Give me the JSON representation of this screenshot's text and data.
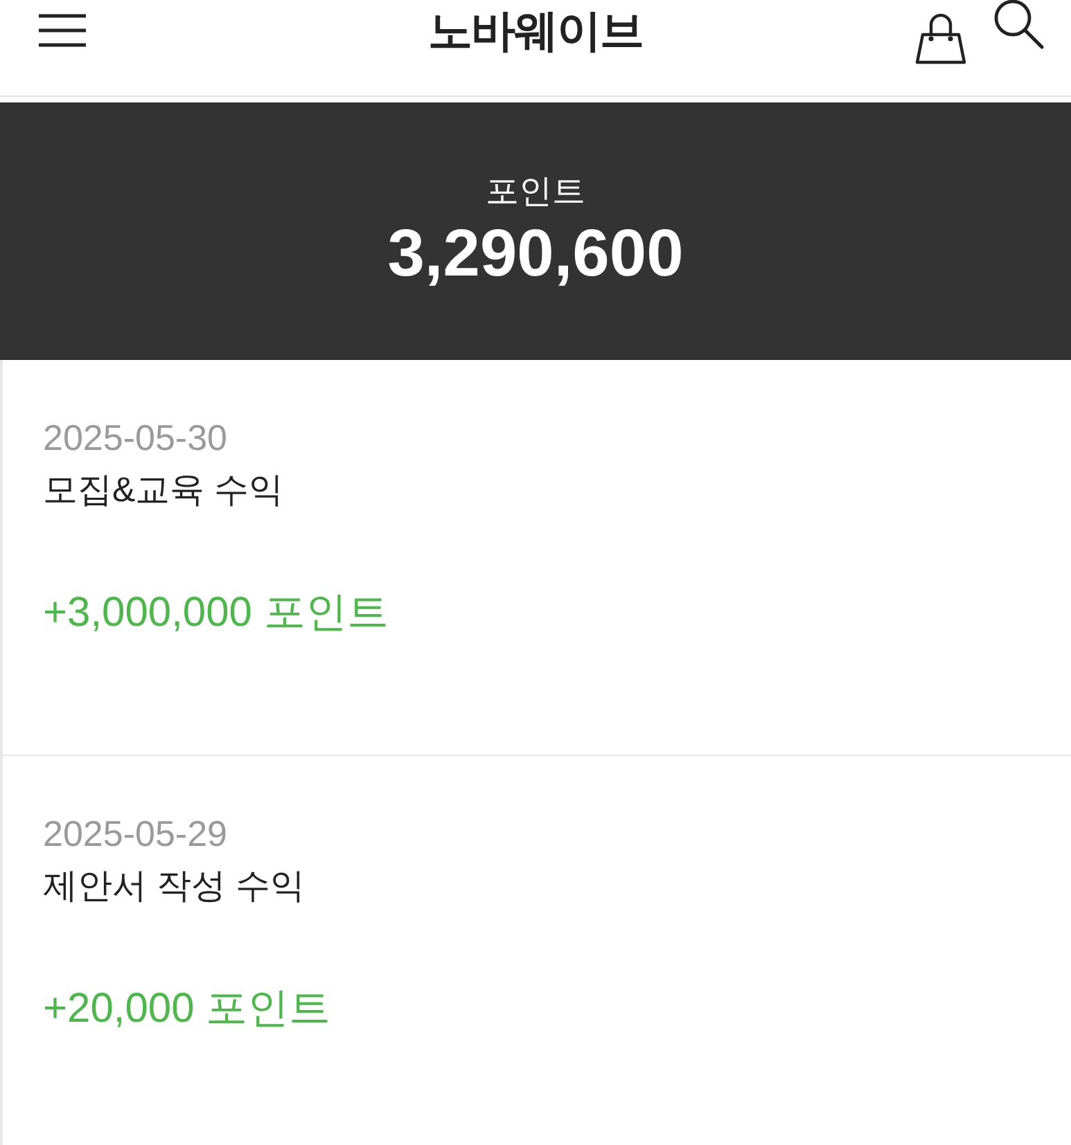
{
  "header": {
    "title": "노바웨이브"
  },
  "points": {
    "label": "포인트",
    "value": "3,290,600"
  },
  "history": [
    {
      "date": "2025-05-30",
      "description": "모집&교육 수익",
      "amount": "+3,000,000 포인트"
    },
    {
      "date": "2025-05-29",
      "description": "제안서 작성 수익",
      "amount": "+20,000 포인트"
    }
  ]
}
